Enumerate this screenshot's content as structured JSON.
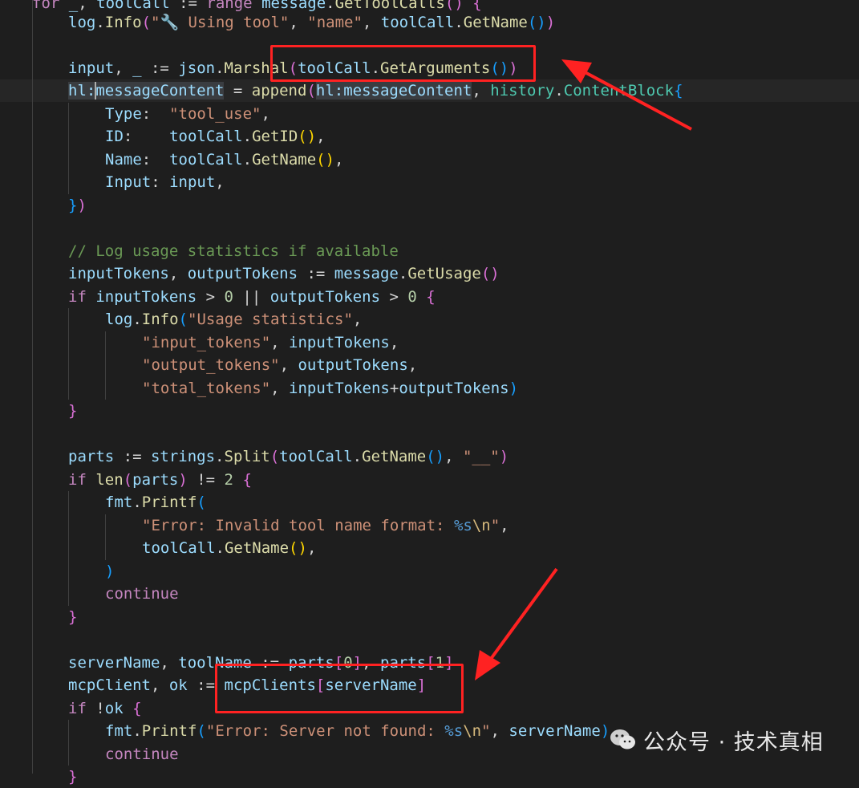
{
  "editor": {
    "lines": [
      {
        "tokens": [
          [
            "kw",
            "for"
          ],
          [
            "op",
            " "
          ],
          [
            "var",
            "_"
          ],
          [
            "op",
            ", "
          ],
          [
            "var",
            "toolCall"
          ],
          [
            "op",
            " := "
          ],
          [
            "kw",
            "range"
          ],
          [
            "op",
            " "
          ],
          [
            "var",
            "message"
          ],
          [
            "op",
            "."
          ],
          [
            "fn",
            "GetToolCalls"
          ],
          [
            "b2",
            "()"
          ],
          [
            "op",
            " "
          ],
          [
            "b2",
            "{"
          ]
        ]
      },
      {
        "tokens": [
          [
            "var",
            "log"
          ],
          [
            "op",
            "."
          ],
          [
            "fn",
            "Info"
          ],
          [
            "b2",
            "("
          ],
          [
            "str",
            "\"🔧 Using tool\""
          ],
          [
            "op",
            ", "
          ],
          [
            "str",
            "\"name\""
          ],
          [
            "op",
            ", "
          ],
          [
            "var",
            "toolCall"
          ],
          [
            "op",
            "."
          ],
          [
            "fn",
            "GetName"
          ],
          [
            "b3",
            "()"
          ],
          [
            "b2",
            ")"
          ]
        ]
      },
      {
        "tokens": []
      },
      {
        "tokens": [
          [
            "var",
            "input"
          ],
          [
            "op",
            ", "
          ],
          [
            "var",
            "_"
          ],
          [
            "op",
            " := "
          ],
          [
            "var",
            "json"
          ],
          [
            "op",
            "."
          ],
          [
            "fn",
            "Marshal"
          ],
          [
            "b2",
            "("
          ],
          [
            "var",
            "toolCall"
          ],
          [
            "op",
            "."
          ],
          [
            "fn",
            "GetArguments"
          ],
          [
            "b3",
            "()"
          ],
          [
            "b2",
            ")"
          ]
        ]
      },
      {
        "tokens": [
          [
            "var",
            "hl:messageContent"
          ],
          [
            "op",
            " = "
          ],
          [
            "fn",
            "append"
          ],
          [
            "b2",
            "("
          ],
          [
            "var",
            "hl:messageContent"
          ],
          [
            "op",
            ", "
          ],
          [
            "typ",
            "history"
          ],
          [
            "op",
            "."
          ],
          [
            "typ",
            "ContentBlock"
          ],
          [
            "b3",
            "{"
          ]
        ]
      },
      {
        "tokens": [
          [
            "var",
            "Type"
          ],
          [
            "op",
            ":  "
          ],
          [
            "str",
            "\"tool_use\""
          ],
          [
            "op",
            ","
          ]
        ]
      },
      {
        "tokens": [
          [
            "var",
            "ID"
          ],
          [
            "op",
            ":    "
          ],
          [
            "var",
            "toolCall"
          ],
          [
            "op",
            "."
          ],
          [
            "fn",
            "GetID"
          ],
          [
            "b1",
            "()"
          ],
          [
            "op",
            ","
          ]
        ]
      },
      {
        "tokens": [
          [
            "var",
            "Name"
          ],
          [
            "op",
            ":  "
          ],
          [
            "var",
            "toolCall"
          ],
          [
            "op",
            "."
          ],
          [
            "fn",
            "GetName"
          ],
          [
            "b1",
            "()"
          ],
          [
            "op",
            ","
          ]
        ]
      },
      {
        "tokens": [
          [
            "var",
            "Input"
          ],
          [
            "op",
            ": "
          ],
          [
            "var",
            "input"
          ],
          [
            "op",
            ","
          ]
        ]
      },
      {
        "tokens": [
          [
            "b3",
            "}"
          ],
          [
            "b2",
            ")"
          ]
        ]
      },
      {
        "tokens": []
      },
      {
        "tokens": [
          [
            "cmt",
            "// Log usage statistics if available"
          ]
        ]
      },
      {
        "tokens": [
          [
            "var",
            "inputTokens"
          ],
          [
            "op",
            ", "
          ],
          [
            "var",
            "outputTokens"
          ],
          [
            "op",
            " := "
          ],
          [
            "var",
            "message"
          ],
          [
            "op",
            "."
          ],
          [
            "fn",
            "GetUsage"
          ],
          [
            "b2",
            "()"
          ]
        ]
      },
      {
        "tokens": [
          [
            "kw",
            "if"
          ],
          [
            "op",
            " "
          ],
          [
            "var",
            "inputTokens"
          ],
          [
            "op",
            " > "
          ],
          [
            "num",
            "0"
          ],
          [
            "op",
            " || "
          ],
          [
            "var",
            "outputTokens"
          ],
          [
            "op",
            " > "
          ],
          [
            "num",
            "0"
          ],
          [
            "op",
            " "
          ],
          [
            "b2",
            "{"
          ]
        ]
      },
      {
        "tokens": [
          [
            "var",
            "log"
          ],
          [
            "op",
            "."
          ],
          [
            "fn",
            "Info"
          ],
          [
            "b3",
            "("
          ],
          [
            "str",
            "\"Usage statistics\""
          ],
          [
            "op",
            ","
          ]
        ]
      },
      {
        "tokens": [
          [
            "str",
            "\"input_tokens\""
          ],
          [
            "op",
            ", "
          ],
          [
            "var",
            "inputTokens"
          ],
          [
            "op",
            ","
          ]
        ]
      },
      {
        "tokens": [
          [
            "str",
            "\"output_tokens\""
          ],
          [
            "op",
            ", "
          ],
          [
            "var",
            "outputTokens"
          ],
          [
            "op",
            ","
          ]
        ]
      },
      {
        "tokens": [
          [
            "str",
            "\"total_tokens\""
          ],
          [
            "op",
            ", "
          ],
          [
            "var",
            "inputTokens"
          ],
          [
            "op",
            "+"
          ],
          [
            "var",
            "outputTokens"
          ],
          [
            "b3",
            ")"
          ]
        ]
      },
      {
        "tokens": [
          [
            "b2",
            "}"
          ]
        ]
      },
      {
        "tokens": []
      },
      {
        "tokens": [
          [
            "var",
            "parts"
          ],
          [
            "op",
            " := "
          ],
          [
            "var",
            "strings"
          ],
          [
            "op",
            "."
          ],
          [
            "fn",
            "Split"
          ],
          [
            "b2",
            "("
          ],
          [
            "var",
            "toolCall"
          ],
          [
            "op",
            "."
          ],
          [
            "fn",
            "GetName"
          ],
          [
            "b3",
            "()"
          ],
          [
            "op",
            ", "
          ],
          [
            "str",
            "\"__\""
          ],
          [
            "b2",
            ")"
          ]
        ]
      },
      {
        "tokens": [
          [
            "kw",
            "if"
          ],
          [
            "op",
            " "
          ],
          [
            "fn",
            "len"
          ],
          [
            "b2",
            "("
          ],
          [
            "var",
            "parts"
          ],
          [
            "b2",
            ")"
          ],
          [
            "op",
            " != "
          ],
          [
            "num",
            "2"
          ],
          [
            "op",
            " "
          ],
          [
            "b2",
            "{"
          ]
        ]
      },
      {
        "tokens": [
          [
            "var",
            "fmt"
          ],
          [
            "op",
            "."
          ],
          [
            "fn",
            "Printf"
          ],
          [
            "b3",
            "("
          ]
        ]
      },
      {
        "tokens": [
          [
            "str",
            "\"Error: Invalid tool name format: "
          ],
          [
            "ctl",
            "%s"
          ],
          [
            "esc",
            "\\n"
          ],
          [
            "str",
            "\""
          ],
          [
            "op",
            ","
          ]
        ]
      },
      {
        "tokens": [
          [
            "var",
            "toolCall"
          ],
          [
            "op",
            "."
          ],
          [
            "fn",
            "GetName"
          ],
          [
            "b1",
            "()"
          ],
          [
            "op",
            ","
          ]
        ]
      },
      {
        "tokens": [
          [
            "b3",
            ")"
          ]
        ]
      },
      {
        "tokens": [
          [
            "kw",
            "continue"
          ]
        ]
      },
      {
        "tokens": [
          [
            "b2",
            "}"
          ]
        ]
      },
      {
        "tokens": []
      },
      {
        "tokens": [
          [
            "var",
            "serverName"
          ],
          [
            "op",
            ", "
          ],
          [
            "var",
            "toolName"
          ],
          [
            "op",
            " := "
          ],
          [
            "var",
            "parts"
          ],
          [
            "b2",
            "["
          ],
          [
            "num",
            "0"
          ],
          [
            "b2",
            "]"
          ],
          [
            "op",
            ", "
          ],
          [
            "var",
            "parts"
          ],
          [
            "b2",
            "["
          ],
          [
            "num",
            "1"
          ],
          [
            "b2",
            "]"
          ]
        ]
      },
      {
        "tokens": [
          [
            "var",
            "mcpClient"
          ],
          [
            "op",
            ", "
          ],
          [
            "var",
            "ok"
          ],
          [
            "op",
            " := "
          ],
          [
            "var",
            "mcpClients"
          ],
          [
            "b2",
            "["
          ],
          [
            "var",
            "serverName"
          ],
          [
            "b2",
            "]"
          ]
        ]
      },
      {
        "tokens": [
          [
            "kw",
            "if"
          ],
          [
            "op",
            " !"
          ],
          [
            "var",
            "ok"
          ],
          [
            "op",
            " "
          ],
          [
            "b2",
            "{"
          ]
        ]
      },
      {
        "tokens": [
          [
            "var",
            "fmt"
          ],
          [
            "op",
            "."
          ],
          [
            "fn",
            "Printf"
          ],
          [
            "b3",
            "("
          ],
          [
            "str",
            "\"Error: Server not found: "
          ],
          [
            "ctl",
            "%s"
          ],
          [
            "esc",
            "\\n"
          ],
          [
            "str",
            "\""
          ],
          [
            "op",
            ", "
          ],
          [
            "var",
            "serverName"
          ],
          [
            "b3",
            ")"
          ]
        ]
      },
      {
        "tokens": [
          [
            "kw",
            "continue"
          ]
        ]
      },
      {
        "tokens": [
          [
            "b2",
            "}"
          ]
        ]
      }
    ]
  },
  "watermark": {
    "text": "公众号 · 技术真相"
  },
  "colors": {
    "background": "#1e1e1e",
    "annotation": "#ff2222"
  },
  "icons": [
    "wechat-logo-icon",
    "annotation-arrow-icon"
  ]
}
